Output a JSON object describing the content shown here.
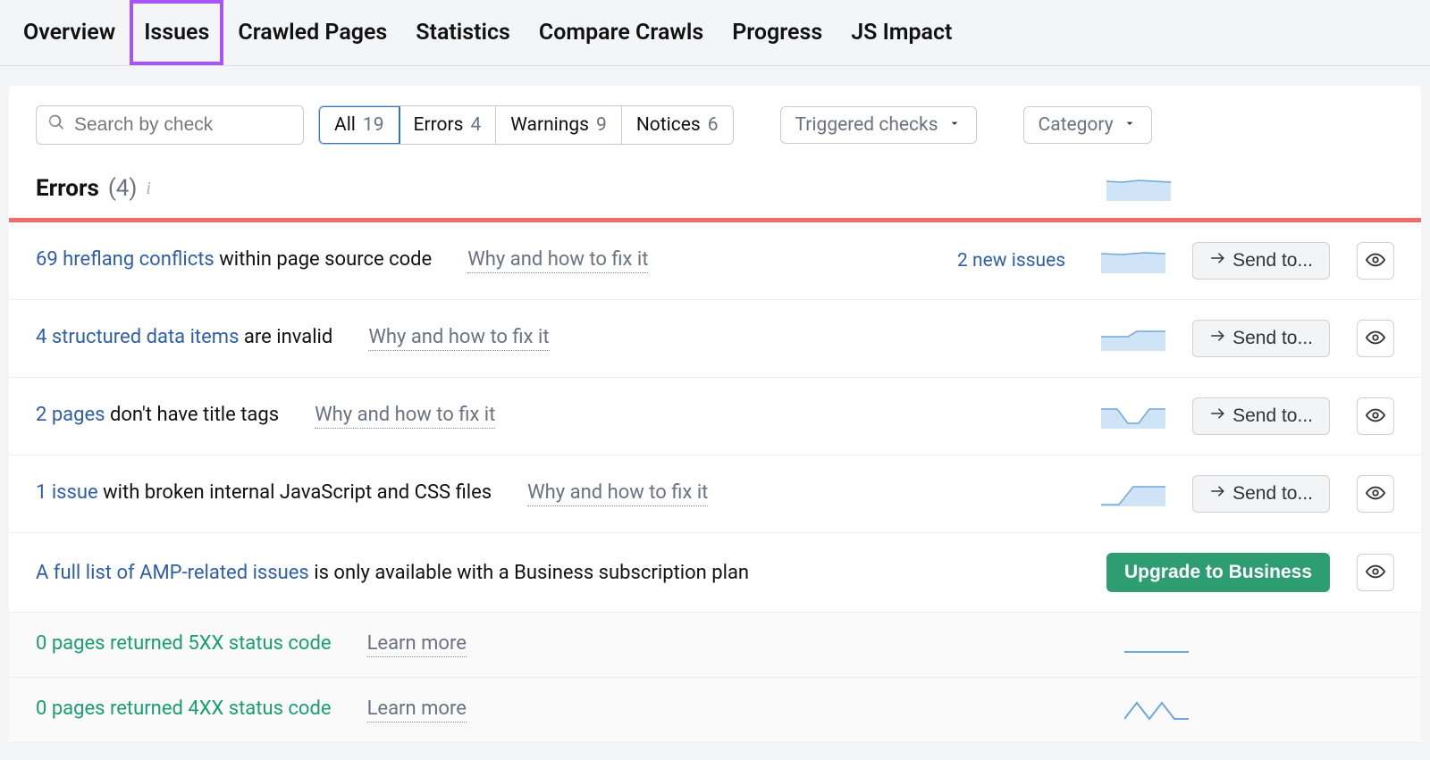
{
  "tabs": {
    "overview": "Overview",
    "issues": "Issues",
    "crawled": "Crawled Pages",
    "statistics": "Statistics",
    "compare": "Compare Crawls",
    "progress": "Progress",
    "jsimpact": "JS Impact"
  },
  "controls": {
    "search_placeholder": "Search by check",
    "seg_all": "All",
    "seg_all_count": "19",
    "seg_errors": "Errors",
    "seg_errors_count": "4",
    "seg_warnings": "Warnings",
    "seg_warnings_count": "9",
    "seg_notices": "Notices",
    "seg_notices_count": "6",
    "dd_triggered": "Triggered checks",
    "dd_category": "Category"
  },
  "section": {
    "title": "Errors",
    "count": "(4)"
  },
  "common": {
    "fix": "Why and how to fix it",
    "learn": "Learn more",
    "sendto": "Send to...",
    "upgrade": "Upgrade to Business"
  },
  "rows": [
    {
      "link": "69 hreflang conflicts",
      "rest": " within page source code",
      "new_issues": "2 new issues"
    },
    {
      "link": "4 structured data items",
      "rest": " are invalid"
    },
    {
      "link": "2 pages",
      "rest": " don't have title tags"
    },
    {
      "link": "1 issue",
      "rest": " with broken internal JavaScript and CSS files"
    }
  ],
  "amp": {
    "link": "A full list of AMP-related issues",
    "rest": " is only available with a Business subscription plan"
  },
  "zero": [
    {
      "text": "0 pages returned 5XX status code"
    },
    {
      "text": "0 pages returned 4XX status code"
    }
  ]
}
